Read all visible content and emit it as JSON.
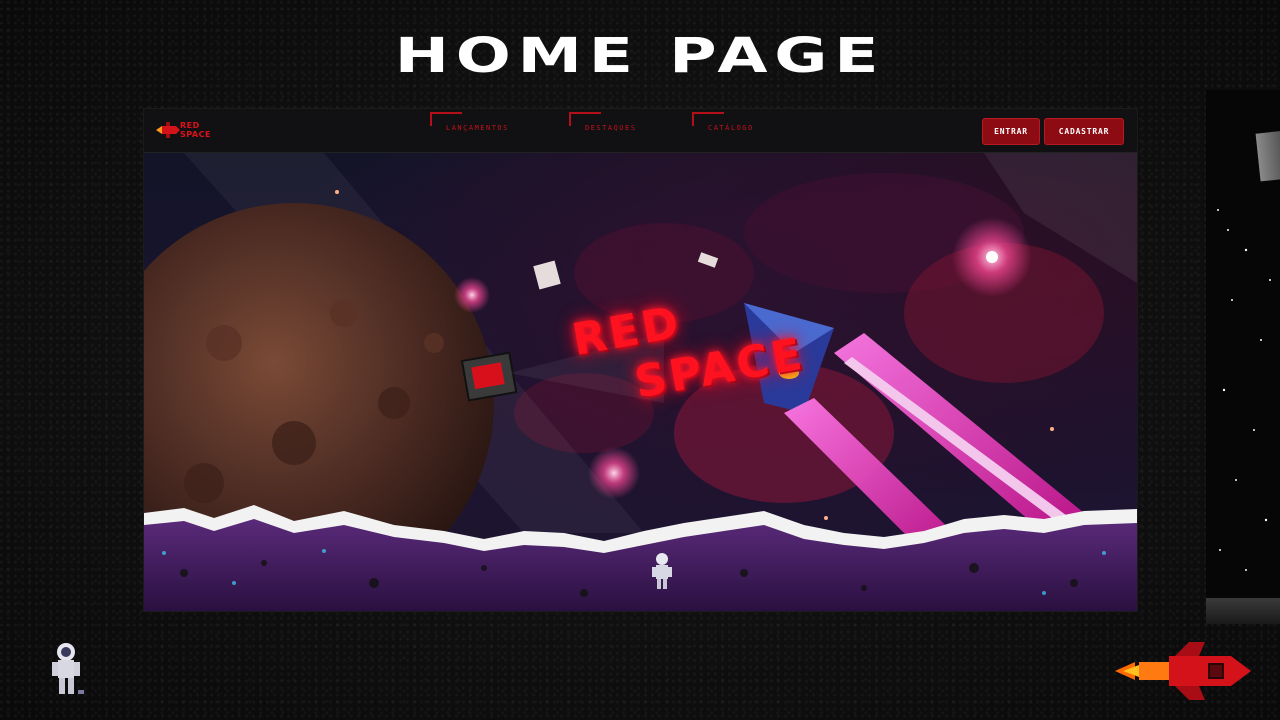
{
  "slide": {
    "title": "HOME PAGE"
  },
  "site": {
    "logo_text": "RED\nSPACE",
    "nav": [
      {
        "label": "LANÇAMENTOS"
      },
      {
        "label": "DESTAQUES"
      },
      {
        "label": "CATÁLOGO"
      }
    ],
    "buttons": {
      "login": "ENTRAR",
      "signup": "CADASTRAR"
    },
    "hero": {
      "title_line1": "RED",
      "title_line2": "SPACE"
    }
  },
  "colors": {
    "brand_red": "#e0101a",
    "button_bg": "#8d0b12",
    "neon_pink": "#ff2bd0",
    "background": "#0b0b0c"
  },
  "icons": [
    "logo-rocket-icon",
    "astronaut-icon",
    "rocket-icon",
    "planet-icon",
    "spaceship-icon",
    "tv-icon"
  ]
}
